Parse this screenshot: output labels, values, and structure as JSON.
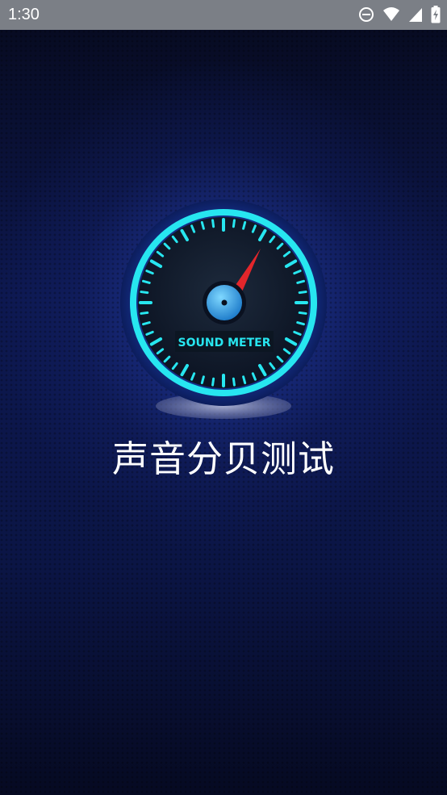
{
  "status_bar": {
    "time": "1:30",
    "icons": [
      "do-not-disturb-icon",
      "wifi-icon",
      "signal-icon",
      "battery-charging-icon"
    ]
  },
  "splash": {
    "logo_text": "SOUND METER",
    "app_title": "声音分贝测试"
  },
  "colors": {
    "status_bar_bg": "#7b7f86",
    "background": "#0d1850",
    "ring_cyan": "#27e6f0",
    "needle_red": "#e3262b"
  }
}
